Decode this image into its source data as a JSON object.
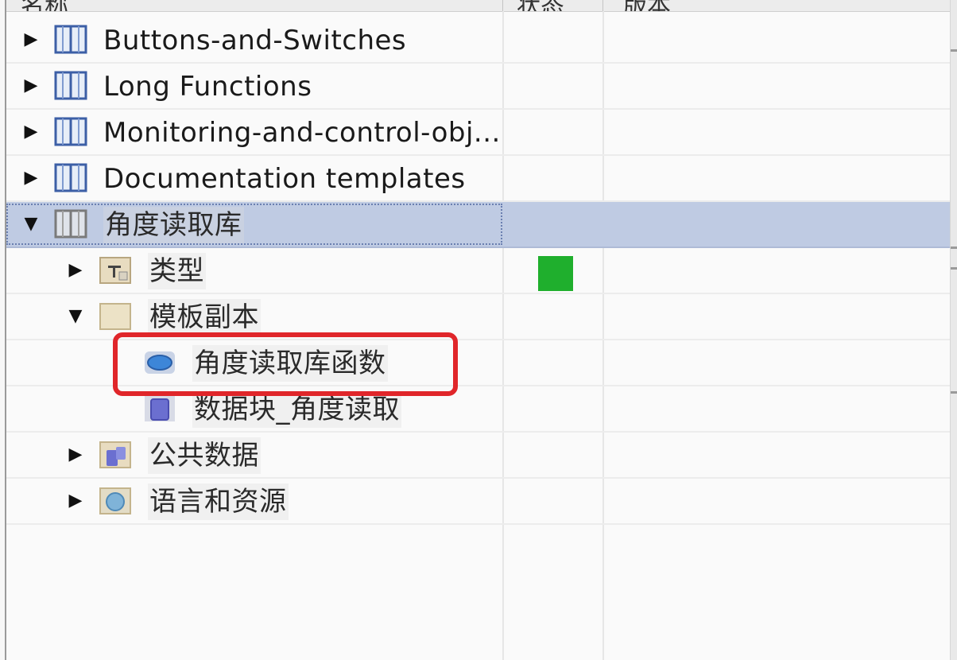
{
  "header": {
    "columns": [
      "名称",
      "状态",
      "版本"
    ]
  },
  "tree": {
    "items": [
      {
        "label": "Buttons-and-Switches",
        "icon": "library-book-icon",
        "expanded": false
      },
      {
        "label": "Long Functions",
        "icon": "library-book-icon",
        "expanded": false
      },
      {
        "label": "Monitoring-and-control-obj...",
        "icon": "library-book-icon",
        "expanded": false
      },
      {
        "label": "Documentation templates",
        "icon": "library-book-icon",
        "expanded": false
      },
      {
        "label": "角度读取库",
        "icon": "library-book-icon",
        "expanded": true,
        "selected": true
      },
      {
        "label": "类型",
        "icon": "types-folder-icon",
        "expanded": false,
        "status_color": "#1faf2d"
      },
      {
        "label": "模板副本",
        "icon": "folder-icon",
        "expanded": true
      },
      {
        "label": "角度读取库函数",
        "icon": "function-block-icon",
        "highlighted": true
      },
      {
        "label": "数据块_角度读取",
        "icon": "data-block-icon"
      },
      {
        "label": "公共数据",
        "icon": "common-data-folder-icon",
        "expanded": false
      },
      {
        "label": "语言和资源",
        "icon": "languages-folder-icon",
        "expanded": false
      }
    ]
  },
  "colors": {
    "selection": "#bfcbe3",
    "highlight_border": "#e0262a",
    "status_ok": "#1faf2d"
  }
}
